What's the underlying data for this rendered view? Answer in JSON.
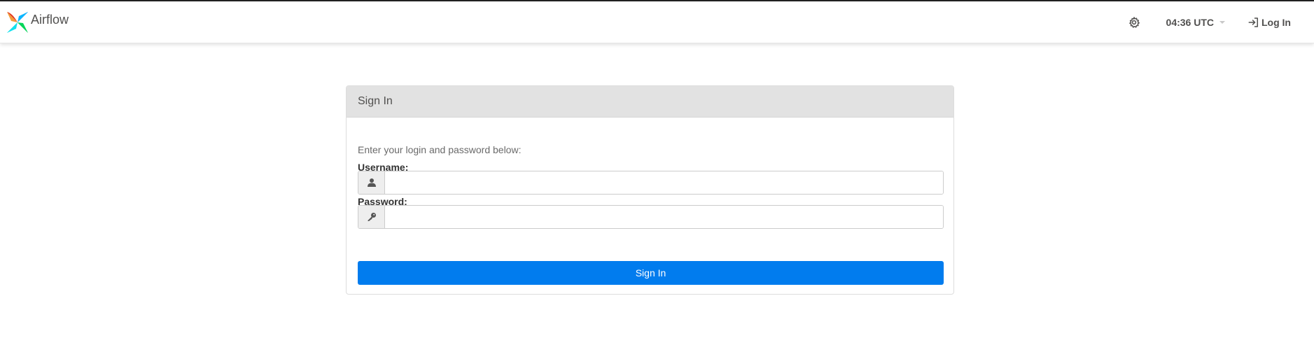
{
  "navbar": {
    "brand_name": "Airflow",
    "clock": "04:36 UTC",
    "login_label": "Log In"
  },
  "login": {
    "heading": "Sign In",
    "intro": "Enter your login and password below:",
    "username_label": "Username:",
    "username_value": "",
    "password_label": "Password:",
    "password_value": "",
    "submit_label": "Sign In"
  },
  "colors": {
    "primary": "#017cee",
    "panel_heading": "#e2e2e2",
    "text": "#51504f"
  },
  "icons": [
    "airflow-logo",
    "gear-icon",
    "caret-down-icon",
    "sign-in-icon",
    "user-icon",
    "key-icon"
  ]
}
